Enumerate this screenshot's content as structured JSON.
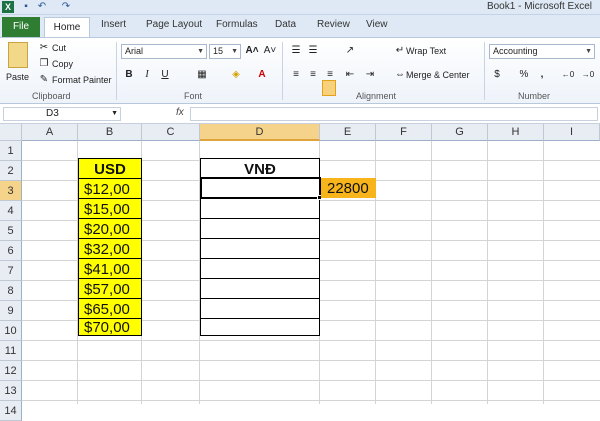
{
  "window": {
    "title": "Book1  -  Microsoft Excel"
  },
  "tabs": {
    "file": "File",
    "home": "Home",
    "insert": "Insert",
    "page_layout": "Page Layout",
    "formulas": "Formulas",
    "data": "Data",
    "review": "Review",
    "view": "View"
  },
  "clipboard": {
    "cut": "Cut",
    "copy": "Copy",
    "format_painter": "Format Painter",
    "paste": "Paste",
    "label": "Clipboard"
  },
  "font": {
    "name": "Arial",
    "size": "15",
    "label": "Font",
    "bold": "B",
    "italic": "I",
    "underline": "U"
  },
  "alignment": {
    "wrap_text": "Wrap Text",
    "merge_center": "Merge & Center",
    "label": "Alignment"
  },
  "number": {
    "format": "Accounting",
    "percent": "%",
    "comma": ",",
    "label": "Number"
  },
  "formula_bar": {
    "name_box": "D3",
    "fx": "fx",
    "formula": ""
  },
  "columns": [
    "A",
    "B",
    "C",
    "D",
    "E",
    "F",
    "G",
    "H",
    "I"
  ],
  "rows": [
    "1",
    "2",
    "3",
    "4",
    "5",
    "6",
    "7",
    "8",
    "9",
    "10",
    "11",
    "12",
    "13",
    "14"
  ],
  "sheet": {
    "B2": "USD",
    "D2": "VNĐ",
    "E3": "22800",
    "usd_values": [
      "$12,00",
      "$15,00",
      "$20,00",
      "$32,00",
      "$41,00",
      "$57,00",
      "$65,00",
      "$70,00"
    ]
  },
  "colors": {
    "yellow": "#ffff00",
    "orange": "#f7b51b",
    "file_tab": "#2f7d32",
    "selection": "#f6d38a"
  },
  "icons": [
    "excel-logo-icon",
    "save-icon",
    "undo-icon",
    "redo-icon",
    "paste-icon",
    "cut-icon",
    "copy-icon",
    "format-painter-icon",
    "grow-font-icon",
    "shrink-font-icon",
    "borders-icon",
    "fill-color-icon",
    "font-color-icon",
    "align-top-icon",
    "align-middle-icon",
    "align-bottom-icon",
    "align-left-icon",
    "align-center-icon",
    "align-right-icon",
    "wrap-text-icon",
    "merge-center-icon",
    "currency-icon",
    "percent-icon",
    "comma-icon",
    "increase-decimal-icon",
    "decrease-decimal-icon"
  ]
}
